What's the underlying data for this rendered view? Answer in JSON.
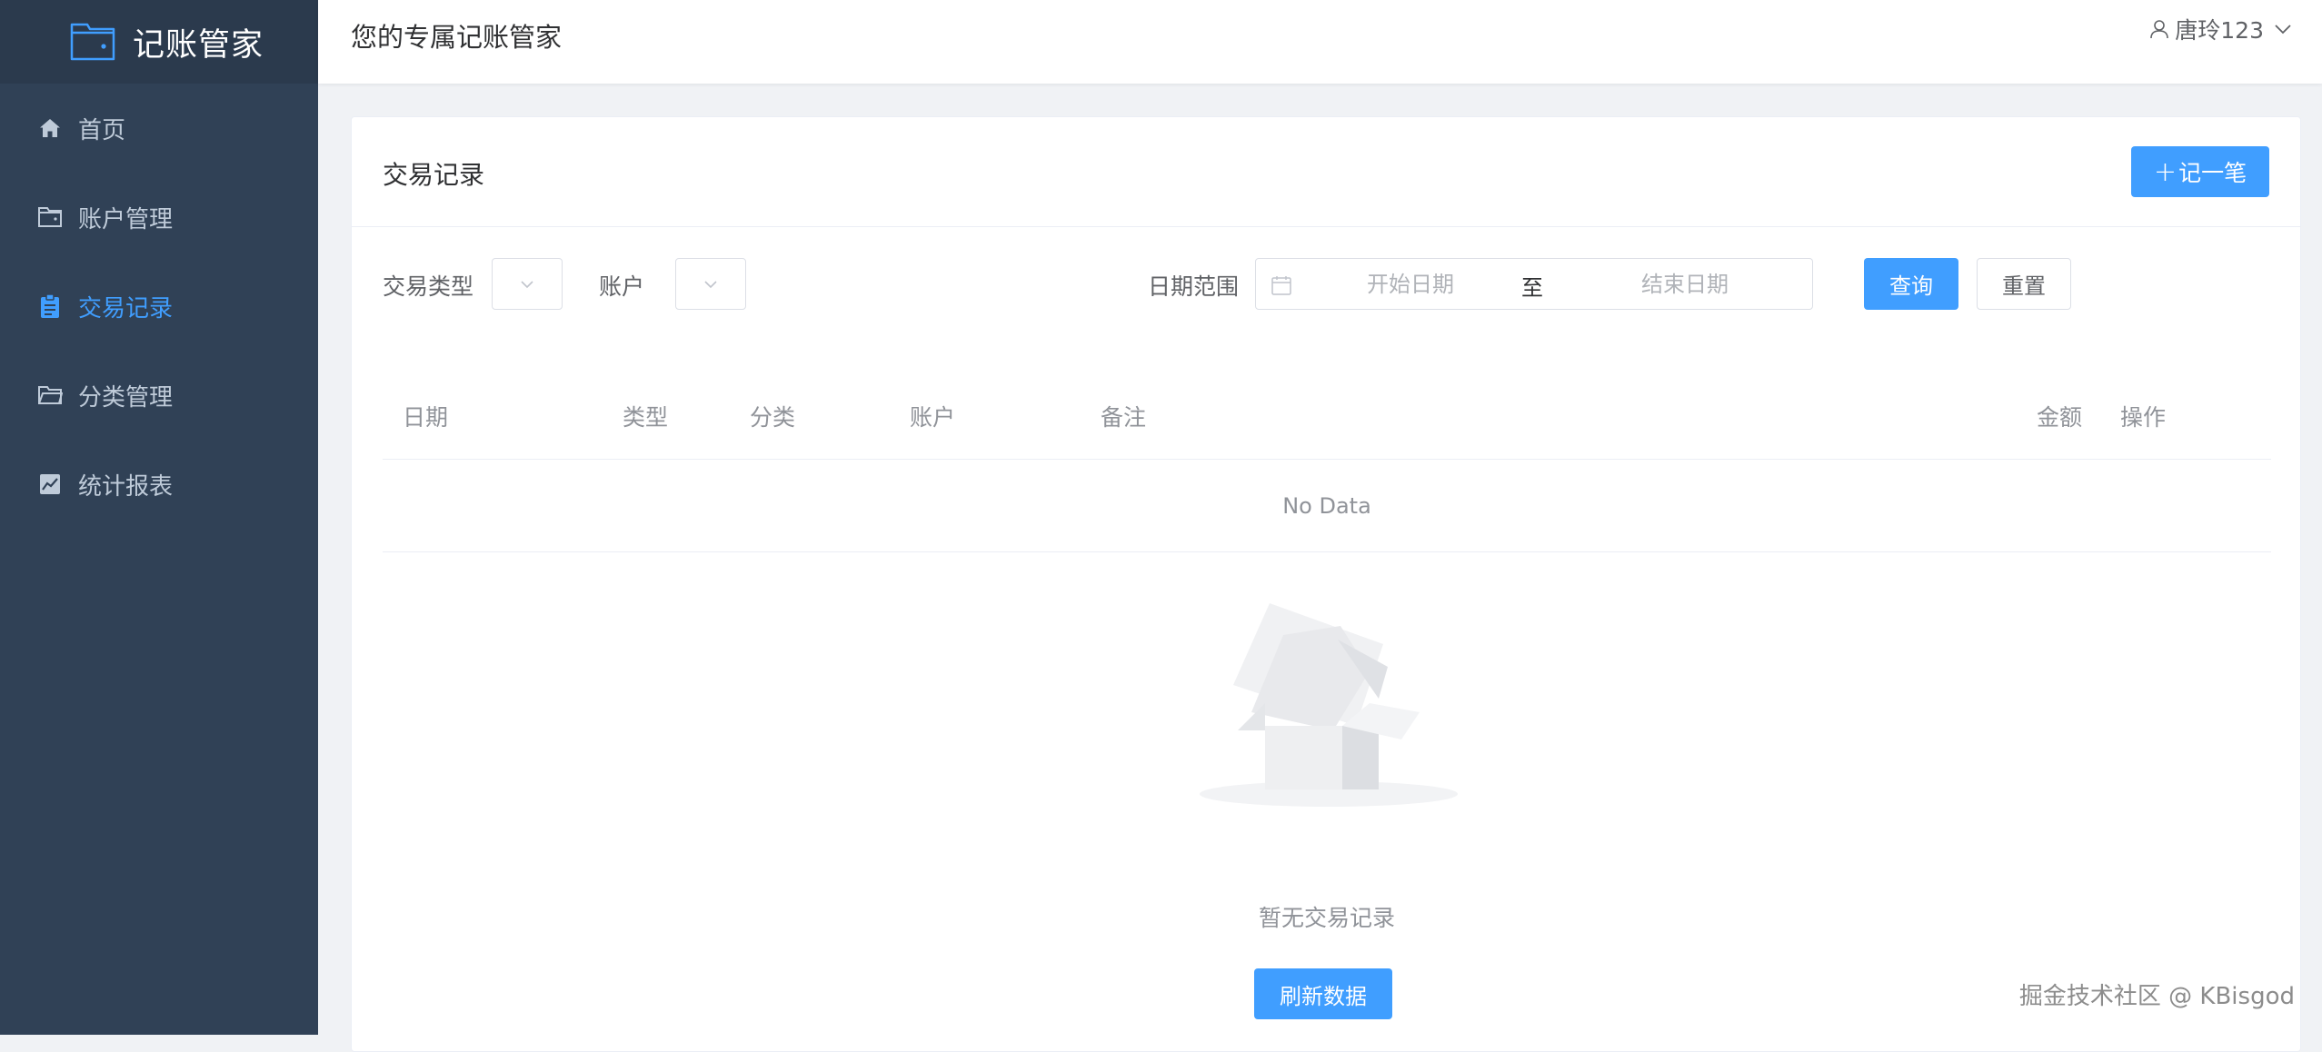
{
  "app": {
    "logo_text": "记账管家"
  },
  "sidebar": {
    "items": [
      {
        "label": "首页",
        "icon": "home-icon"
      },
      {
        "label": "账户管理",
        "icon": "wallet-icon"
      },
      {
        "label": "交易记录",
        "icon": "clipboard-icon",
        "active": true
      },
      {
        "label": "分类管理",
        "icon": "folder-icon"
      },
      {
        "label": "统计报表",
        "icon": "chart-icon"
      }
    ]
  },
  "header": {
    "title": "您的专属记账管家",
    "username": "唐玲123"
  },
  "card": {
    "title": "交易记录",
    "add_button": "记一笔",
    "add_button_icon": "+"
  },
  "filters": {
    "type_label": "交易类型",
    "account_label": "账户",
    "date_label": "日期范围",
    "start_placeholder": "开始日期",
    "separator": "至",
    "end_placeholder": "结束日期",
    "query_button": "查询",
    "reset_button": "重置"
  },
  "table": {
    "columns": [
      "日期",
      "类型",
      "分类",
      "账户",
      "备注",
      "金额",
      "操作"
    ],
    "empty_text": "No Data"
  },
  "empty_state": {
    "description": "暂无交易记录",
    "refresh_button": "刷新数据"
  },
  "watermark": "掘金技术社区 @ KBisgod",
  "colors": {
    "sidebar_bg": "#304156",
    "logo_bg": "#2b3a4d",
    "accent": "#409eff",
    "menu_text": "#bfcbd9"
  }
}
